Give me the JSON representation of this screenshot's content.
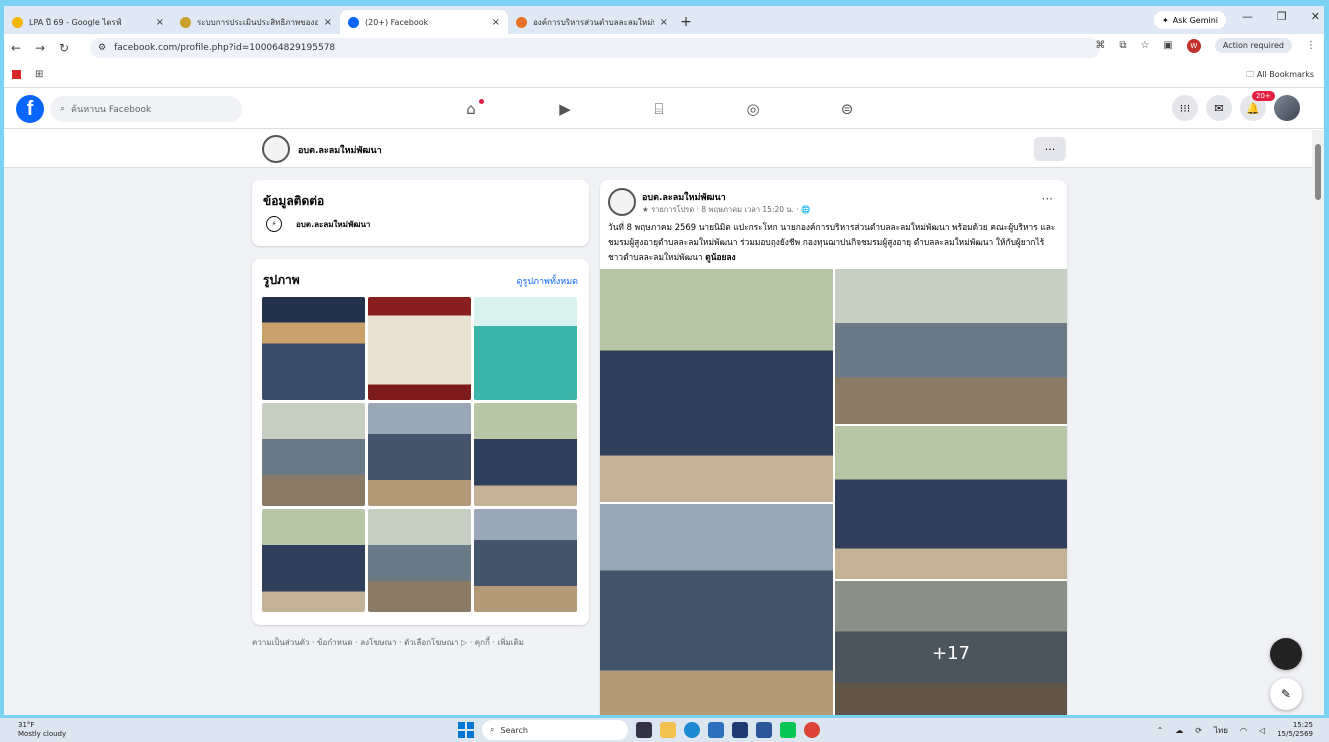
{
  "browser": {
    "tabs": [
      {
        "title": "LPA ปี 69 - Google ไดรฟ์",
        "color": "#f4b400"
      },
      {
        "title": "ระบบการประเมินประสิทธิภาพขององค์",
        "color": "#c8a02a"
      },
      {
        "title": "(20+) Facebook",
        "color": "#0866ff"
      },
      {
        "title": "องค์การบริหารส่วนตำบลละลมใหม่พัฒ",
        "color": "#e8702a"
      }
    ],
    "new_tab": "+",
    "gemini": "Ask Gemini",
    "url": "facebook.com/profile.php?id=100064829195578",
    "profile_initial": "W",
    "action_required": "Action required",
    "all_bookmarks": "All Bookmarks"
  },
  "fb": {
    "logo": "f",
    "search_placeholder": "ค้นหาบน Facebook",
    "notif_badge": "20+"
  },
  "page": {
    "name": "อบต.ละลมใหม่พัฒนา",
    "more": "···"
  },
  "contact": {
    "title": "ข้อมูลติดต่อ",
    "messenger": "อบต.ละลมใหม่พัฒนา"
  },
  "photos": {
    "title": "รูปภาพ",
    "see_all": "ดูรูปภาพทั้งหมด"
  },
  "footer": "ความเป็นส่วนตัว · ข้อกำหนด · ลงโฆษณา · ตัวเลือกโฆษณา ▷ · คุกกี้ · เพิ่มเติม",
  "post": {
    "author": "อบต.ละลมใหม่พัฒนา",
    "meta": "★ รายการโปรด · 8 พฤษภาคม เวลา 15:20 น. · 🌐",
    "text": "วันที่ 8 พฤษภาคม 2569  นายนิมิต  แปะกระโทก นายกองค์การบริหารส่วนตำบลละลมใหม่พัฒนา พร้อมด้วย คณะผู้บริหาร  และชมรมผู้สูงอายุตำบลละลมใหม่พัฒนา ร่วมมอบถุงยังชีพ กองทุนฌาปนกิจชมรมผู้สูงอายุ ตำบลละลมใหม่พัฒนา ให้กับผู้ยากไร้ชาวตำบลละลมใหม่พัฒนา",
    "tag": "ดูน้อยลง",
    "more_count": "+17"
  },
  "taskbar": {
    "temp": "31°F",
    "weather": "Mostly cloudy",
    "search": "Search",
    "lang": "ไทย",
    "time": "15:25",
    "date": "15/5/2569"
  }
}
